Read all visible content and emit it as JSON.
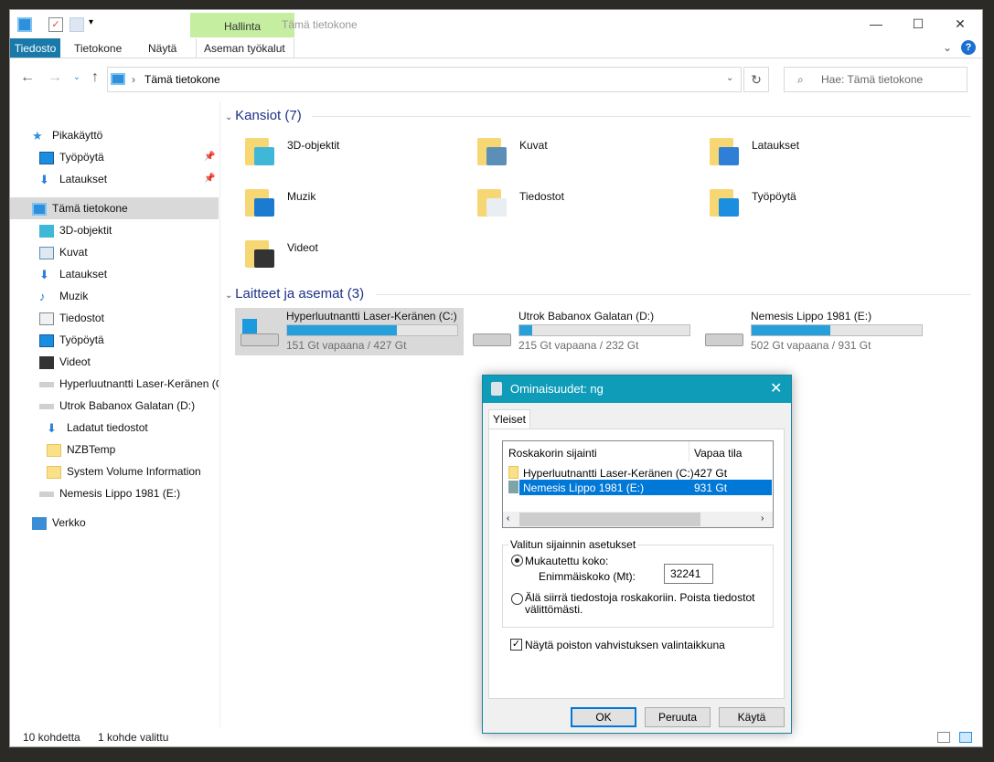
{
  "window": {
    "title": "Tämä tietokone",
    "context_tab": "Hallinta",
    "controls": {
      "minimize": "—",
      "maximize": "☐",
      "close": "✕"
    }
  },
  "ribbon": {
    "tabs": [
      "Tiedosto",
      "Tietokone",
      "Näytä",
      "Aseman työkalut"
    ],
    "help": "?"
  },
  "address": {
    "path": "Tämä tietokone",
    "separator": "›",
    "search_placeholder": "Hae: Tämä tietokone"
  },
  "nav_pane": [
    {
      "label": "Pikakäyttö",
      "icon": "star-icon",
      "level": 0
    },
    {
      "label": "Työpöytä",
      "icon": "desktop-icon",
      "level": 1,
      "pinned": true
    },
    {
      "label": "Lataukset",
      "icon": "download-icon",
      "level": 1,
      "pinned": true
    },
    {
      "label": "Tämä tietokone",
      "icon": "computer-icon",
      "level": 0,
      "selected": true
    },
    {
      "label": "3D-objektit",
      "icon": "cube-icon",
      "level": 1
    },
    {
      "label": "Kuvat",
      "icon": "pictures-icon",
      "level": 1
    },
    {
      "label": "Lataukset",
      "icon": "download-icon",
      "level": 1
    },
    {
      "label": "Muzik",
      "icon": "music-icon",
      "level": 1
    },
    {
      "label": "Tiedostot",
      "icon": "documents-icon",
      "level": 1
    },
    {
      "label": "Työpöytä",
      "icon": "desktop-icon",
      "level": 1
    },
    {
      "label": "Videot",
      "icon": "video-icon",
      "level": 1
    },
    {
      "label": "Hyperluutnantti Laser-Keränen (C:)",
      "icon": "drive-icon",
      "level": 1
    },
    {
      "label": "Utrok Babanox Galatan (D:)",
      "icon": "drive-icon",
      "level": 1
    },
    {
      "label": "Ladatut tiedostot",
      "icon": "download-icon",
      "level": 2
    },
    {
      "label": "NZBTemp",
      "icon": "folder-icon",
      "level": 2
    },
    {
      "label": "System Volume Information",
      "icon": "folder-icon",
      "level": 2
    },
    {
      "label": "Nemesis Lippo 1981 (E:)",
      "icon": "drive-icon",
      "level": 1
    },
    {
      "label": "Verkko",
      "icon": "network-icon",
      "level": 0
    }
  ],
  "folders_section": "Kansiot (7)",
  "folders": [
    {
      "label": "3D-objektit",
      "overlay": "#3fb7d6"
    },
    {
      "label": "Kuvat",
      "overlay": "#5b8fb8"
    },
    {
      "label": "Lataukset",
      "overlay": "#2f7fd6"
    },
    {
      "label": "Muzik",
      "overlay": "#1a7bd0"
    },
    {
      "label": "Tiedostot",
      "overlay": "#e9eef2"
    },
    {
      "label": "Työpöytä",
      "overlay": "#1c8ee0"
    },
    {
      "label": "Videot",
      "overlay": "#333333"
    }
  ],
  "drives_section": "Laitteet ja asemat (3)",
  "drives": [
    {
      "name": "Hyperluutnantti Laser-Keränen (C:)",
      "free": "151 Gt vapaana / 427 Gt",
      "used_percent": 64.6,
      "selected": true
    },
    {
      "name": "Utrok Babanox Galatan (D:)",
      "free": "215 Gt vapaana / 232 Gt",
      "used_percent": 7.3
    },
    {
      "name": "Nemesis Lippo 1981 (E:)",
      "free": "502 Gt vapaana / 931 Gt",
      "used_percent": 46.1
    }
  ],
  "status": {
    "count": "10 kohdetta",
    "selected": "1 kohde valittu"
  },
  "dialog": {
    "title": "Ominaisuudet:  ng",
    "tab": "Yleiset",
    "columns": [
      "Roskakorin sijainti",
      "Vapaa tila"
    ],
    "rows": [
      {
        "location": "Hyperluutnantti Laser-Keränen (C:)",
        "space": "427 Gt"
      },
      {
        "location": "Nemesis Lippo 1981 (E:)",
        "space": "931 Gt",
        "selected": true
      }
    ],
    "group": "Valitun sijainnin asetukset",
    "custom_size": "Mukautettu koko:",
    "max_size_label": "Enimmäiskoko (Mt):",
    "max_size_value": "32241",
    "no_move": "Älä siirrä tiedostoja roskakoriin. Poista tiedostot välittömästi.",
    "confirm": "Näytä poiston vahvistuksen valintaikkuna",
    "confirm_checked": true,
    "custom_selected": true,
    "buttons": [
      "OK",
      "Peruuta",
      "Käytä"
    ]
  },
  "colors": {
    "accent": "#0e9cb9",
    "selection": "#0078d7",
    "file_tab": "#1979a9",
    "context_tab": "#c5eea0"
  }
}
